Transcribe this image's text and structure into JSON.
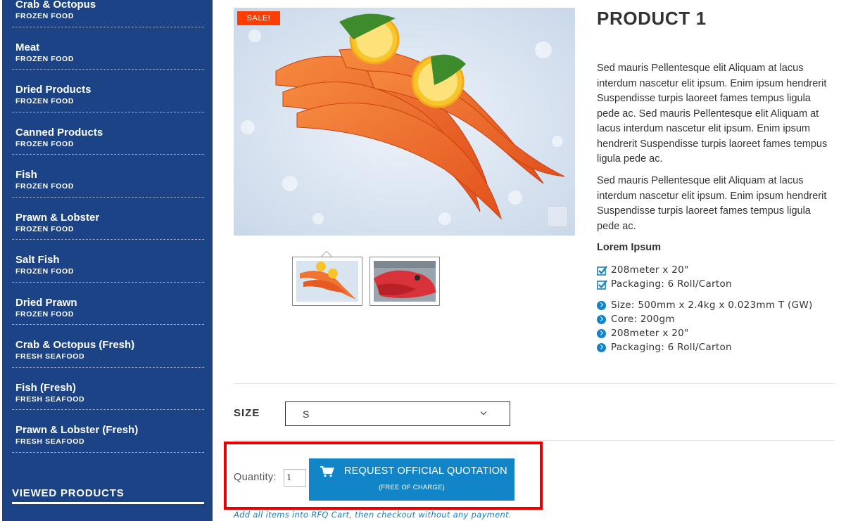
{
  "sidebar": {
    "categories": [
      {
        "name": "Crab & Octopus",
        "type": "FROZEN FOOD"
      },
      {
        "name": "Meat",
        "type": "FROZEN FOOD"
      },
      {
        "name": "Dried Products",
        "type": "FROZEN FOOD"
      },
      {
        "name": "Canned Products",
        "type": "FROZEN FOOD"
      },
      {
        "name": "Fish",
        "type": "FROZEN FOOD"
      },
      {
        "name": "Prawn & Lobster",
        "type": "FROZEN FOOD"
      },
      {
        "name": "Salt Fish",
        "type": "FROZEN FOOD"
      },
      {
        "name": "Dried Prawn",
        "type": "FROZEN FOOD"
      },
      {
        "name": "Crab & Octopus (Fresh)",
        "type": "FRESH SEAFOOD"
      },
      {
        "name": "Fish (Fresh)",
        "type": "FRESH SEAFOOD"
      },
      {
        "name": "Prawn & Lobster (Fresh)",
        "type": "FRESH SEAFOOD"
      }
    ],
    "viewed_title": "VIEWED PRODUCTS"
  },
  "gallery": {
    "badge": "SALE!",
    "thumbnails": [
      {
        "icon": "shrimp-on-ice-image"
      },
      {
        "icon": "red-fish-image"
      }
    ]
  },
  "product": {
    "title": "PRODUCT 1",
    "description_1": "Sed mauris Pellentesque elit Aliquam at lacus interdum nascetur elit ipsum. Enim ipsum hendrerit Suspendisse turpis laoreet fames tempus ligula pede ac. Sed mauris Pellentesque elit Aliquam at lacus interdum nascetur elit ipsum. Enim ipsum hendrerit Suspendisse turpis laoreet fames tempus ligula pede ac.",
    "description_2": "Sed mauris Pellentesque elit Aliquam at lacus interdum nascetur elit ipsum. Enim ipsum hendrerit Suspendisse turpis laoreet fames tempus ligula pede ac.",
    "features_heading": "Lorem Ipsum",
    "checked_features": [
      "208meter x 20\"",
      "Packaging: 6 Roll/Carton"
    ],
    "bullet_features": [
      "Size: 500mm x 2.4kg x 0.023mm T (GW)",
      "Core: 200gm",
      "208meter x 20\"",
      "Packaging: 6 Roll/Carton"
    ]
  },
  "options": {
    "size_label": "SIZE",
    "size_selected": "S"
  },
  "purchase": {
    "quantity_label": "Quantity:",
    "quantity_value": "1",
    "rfq_label": "REQUEST OFFICIAL QUOTATION",
    "rfq_sublabel": "(FREE OF CHARGE)",
    "rfq_note": "Add all items into RFQ Cart, then checkout without any payment."
  },
  "colors": {
    "sidebar_bg": "#1b4385",
    "accent": "#1285c8",
    "sale": "#ff3d00",
    "highlight_box": "#e80000"
  }
}
